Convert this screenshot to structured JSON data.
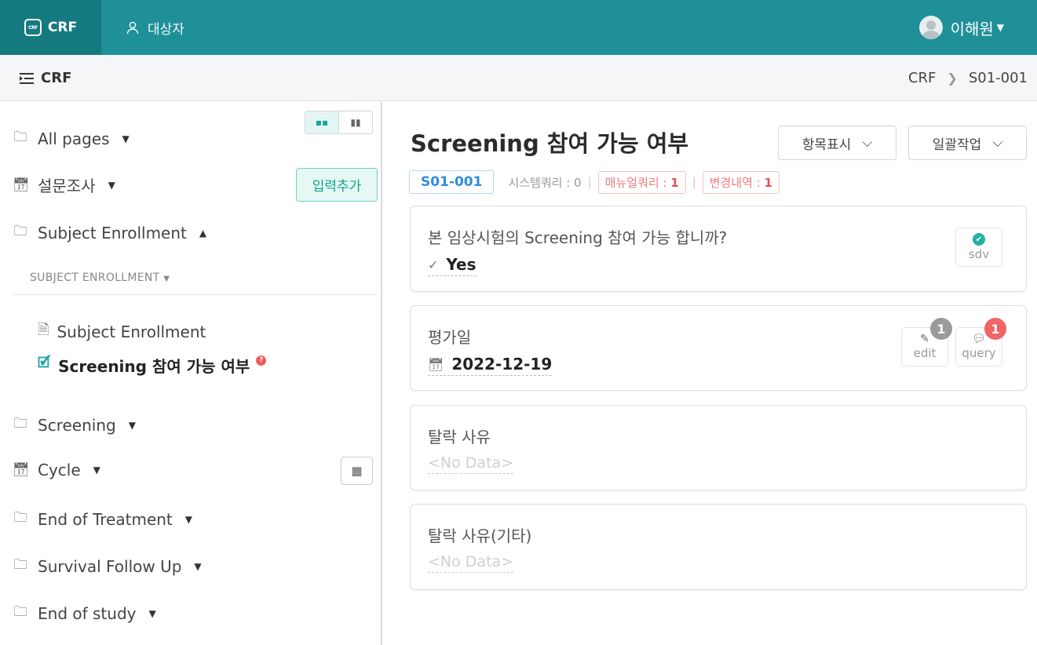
{
  "header": {
    "brand_icon": "CRF",
    "brand": "CRF",
    "subject_nav": "대상자",
    "user_name": "이해원"
  },
  "subbar": {
    "title": "CRF",
    "breadcrumb": [
      "CRF",
      "S01-001"
    ]
  },
  "sidebar": {
    "add_button": "입력추가",
    "groups": [
      {
        "label": "All pages",
        "icon": "folder-icon",
        "expanded": false
      },
      {
        "label": "설문조사",
        "icon": "calendar-icon",
        "expanded": false
      },
      {
        "label": "Subject Enrollment",
        "icon": "folder-icon",
        "expanded": true
      },
      {
        "label": "Screening",
        "icon": "folder-icon",
        "expanded": false
      },
      {
        "label": "Cycle",
        "icon": "calendar-icon",
        "expanded": false
      },
      {
        "label": "End of Treatment",
        "icon": "folder-icon",
        "expanded": false
      },
      {
        "label": "Survival Follow Up",
        "icon": "folder-icon",
        "expanded": false
      },
      {
        "label": "End of study",
        "icon": "folder-icon",
        "expanded": false
      }
    ],
    "section_label": "SUBJECT ENROLLMENT",
    "pages": [
      {
        "label": "Subject Enrollment",
        "active": false
      },
      {
        "label": "Screening 참여 가능 여부",
        "active": true,
        "has_query": true
      }
    ]
  },
  "main": {
    "title": "Screening 참여 가능 여부",
    "display_dropdown": "항목표시",
    "batch_dropdown": "일괄작업",
    "subject_id": "S01-001",
    "system_query": "시스템쿼리 : 0",
    "manual_query_label": "매뉴얼쿼리 : ",
    "manual_query_count": "1",
    "change_label": "변경내역 : ",
    "change_count": "1",
    "items": [
      {
        "question": "본 임상시험의 Screening 참여 가능 합니까?",
        "answer": "Yes",
        "sdv_label": "sdv"
      },
      {
        "question": "평가일",
        "answer": "2022-12-19",
        "edit_label": "edit",
        "edit_count": "1",
        "query_label": "query",
        "query_count": "1"
      },
      {
        "question": "탈락 사유",
        "answer": "<No Data>"
      },
      {
        "question": "탈락 사유(기타)",
        "answer": "<No Data>"
      }
    ]
  },
  "colors": {
    "header": "#1f9098",
    "brand_bg": "#157a80",
    "accent": "#1aa59b",
    "alert": "#f06565"
  }
}
